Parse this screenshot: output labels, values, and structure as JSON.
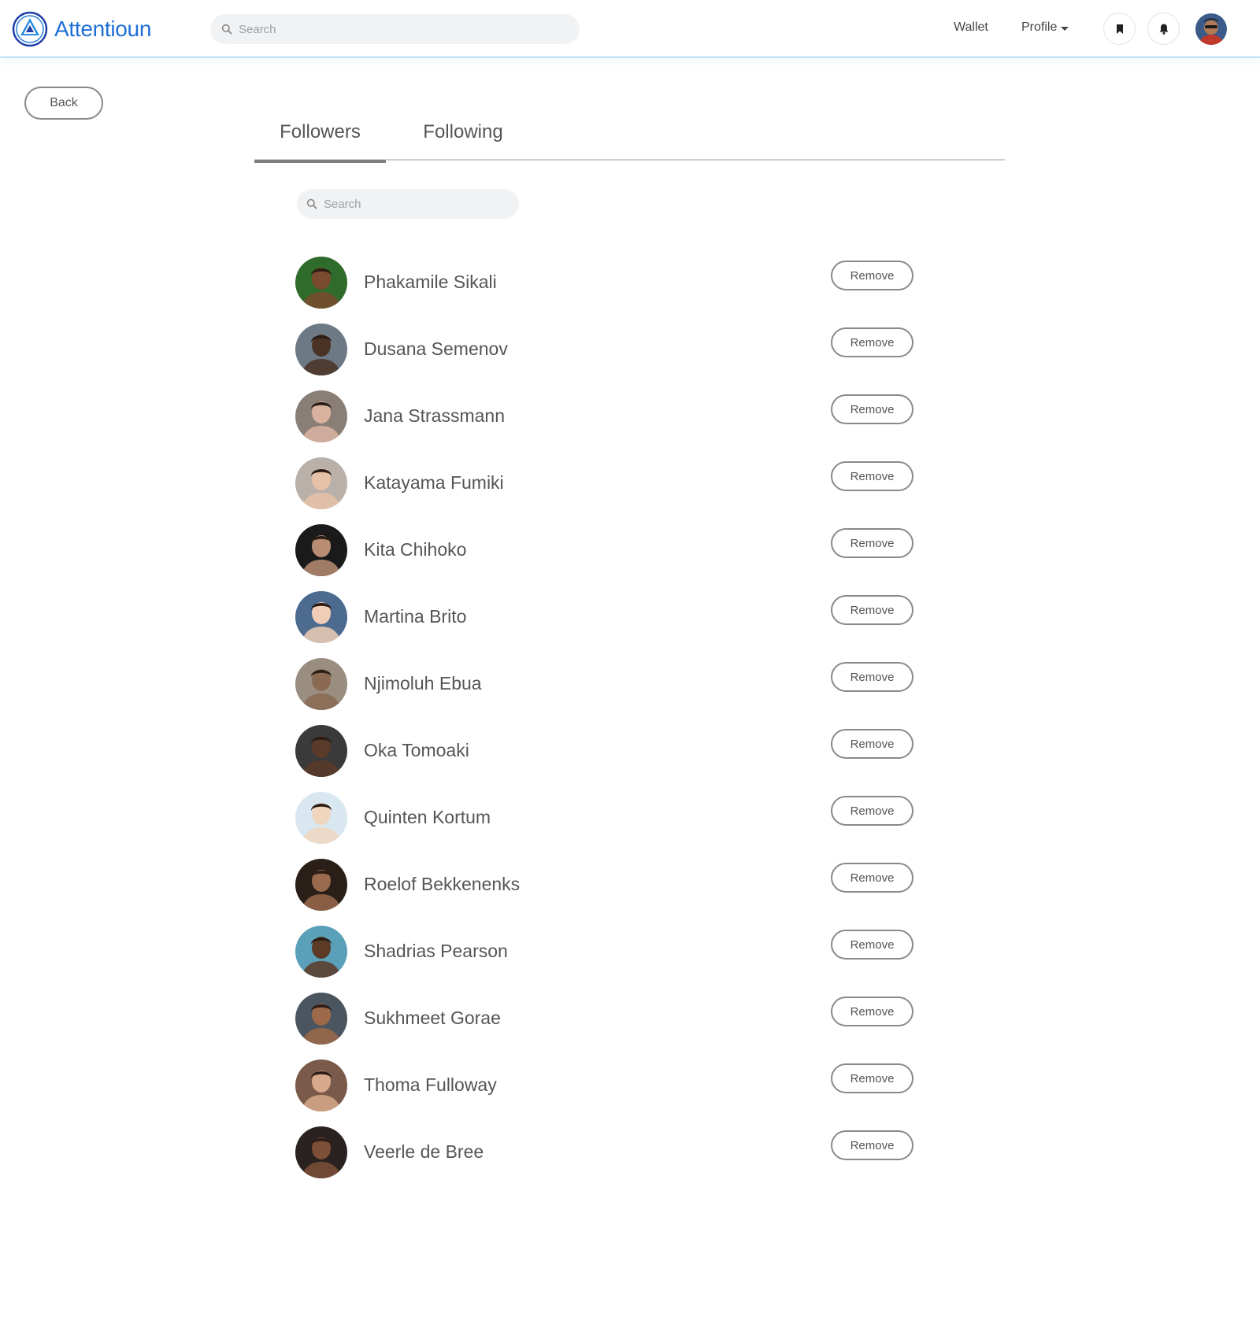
{
  "header": {
    "brand": "Attentioun",
    "search_placeholder": "Search",
    "nav": {
      "wallet": "Wallet",
      "profile": "Profile"
    },
    "icons": [
      "bookmark-icon",
      "bell-icon"
    ],
    "accent_color": "#1f6fd6"
  },
  "back_label": "Back",
  "tabs": [
    {
      "label": "Followers",
      "active": true
    },
    {
      "label": "Following",
      "active": false
    }
  ],
  "list_search_placeholder": "Search",
  "remove_label": "Remove",
  "followers": [
    {
      "name": "Phakamile Sikali",
      "tone": "#7a4b2e",
      "bg": "#2f6b2a"
    },
    {
      "name": "Dusana Semenov",
      "tone": "#4a3324",
      "bg": "#6d7a86"
    },
    {
      "name": "Jana Strassmann",
      "tone": "#d9b3a0",
      "bg": "#8a7f77"
    },
    {
      "name": "Katayama Fumiki",
      "tone": "#e5c2a8",
      "bg": "#b9b1a9"
    },
    {
      "name": "Kita Chihoko",
      "tone": "#b98d73",
      "bg": "#1a1a1a"
    },
    {
      "name": "Martina Brito",
      "tone": "#efcdb6",
      "bg": "#4d6b8f"
    },
    {
      "name": "Njimoluh Ebua",
      "tone": "#8a6a52",
      "bg": "#9a8e80"
    },
    {
      "name": "Oka Tomoaki",
      "tone": "#5a3a28",
      "bg": "#3a3a3a"
    },
    {
      "name": "Quinten Kortum",
      "tone": "#f0d6bf",
      "bg": "#d9e7f0"
    },
    {
      "name": "Roelof Bekkenenks",
      "tone": "#9a6a4e",
      "bg": "#2a1e18"
    },
    {
      "name": "Shadrias Pearson",
      "tone": "#5b3a26",
      "bg": "#5aa0b8"
    },
    {
      "name": "Sukhmeet Gorae",
      "tone": "#9c6a49",
      "bg": "#4b5560"
    },
    {
      "name": "Thoma Fulloway",
      "tone": "#d7a98a",
      "bg": "#7a5a4a"
    },
    {
      "name": "Veerle de Bree",
      "tone": "#7c5038",
      "bg": "#2a2220"
    }
  ]
}
